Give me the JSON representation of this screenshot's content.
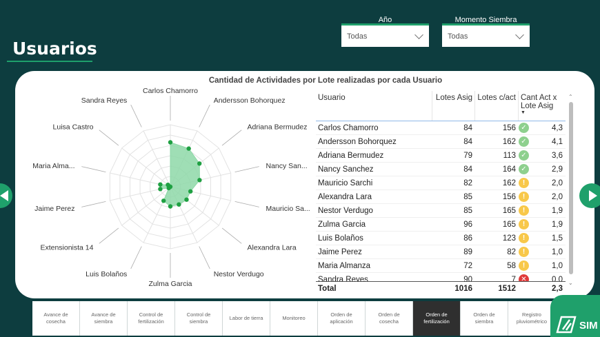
{
  "page": {
    "title": "Usuarios"
  },
  "filters": [
    {
      "label": "Año",
      "value": "Todas"
    },
    {
      "label": "Momento Siembra",
      "value": "Todas"
    }
  ],
  "chart_data": {
    "type": "radar",
    "title": "Cantidad de Actividades por Lote realizadas por cada Usuario",
    "categories": [
      "Carlos Chamorro",
      "Andersson Bohorquez",
      "Adriana Bermudez",
      "Nancy San...",
      "Mauricio Sa...",
      "Alexandra Lara",
      "Nestor Verdugo",
      "Zulma Garcia",
      "Luis Bolaños",
      "Extensionista 14",
      "Jaime Perez",
      "Maria Alma...",
      "Luisa Castro",
      "Sandra Reyes"
    ],
    "values": [
      4.3,
      4.1,
      3.6,
      2.9,
      2.0,
      2.0,
      1.9,
      1.9,
      1.5,
      0.2,
      1.0,
      1.0,
      0.3,
      0.0
    ],
    "rlim": [
      0,
      6
    ],
    "grid": true,
    "fill_color": "#8ed8a8",
    "point_color": "#1fa042"
  },
  "table": {
    "headers": {
      "user": "Usuario",
      "lotes_asig": "Lotes Asig",
      "lotes_cact": "Lotes c/act",
      "cant_act": "Cant Act x Lote Asig"
    },
    "sort_indicator": "▼",
    "rows": [
      {
        "user": "Carlos Chamorro",
        "la": "84",
        "lc": "156",
        "status": "ok",
        "value": "4,3"
      },
      {
        "user": "Andersson Bohorquez",
        "la": "84",
        "lc": "162",
        "status": "ok",
        "value": "4,1"
      },
      {
        "user": "Adriana Bermudez",
        "la": "79",
        "lc": "113",
        "status": "ok",
        "value": "3,6"
      },
      {
        "user": "Nancy Sanchez",
        "la": "84",
        "lc": "164",
        "status": "ok",
        "value": "2,9"
      },
      {
        "user": "Mauricio Sarchi",
        "la": "82",
        "lc": "162",
        "status": "warn",
        "value": "2,0"
      },
      {
        "user": "Alexandra Lara",
        "la": "85",
        "lc": "156",
        "status": "warn",
        "value": "2,0"
      },
      {
        "user": "Nestor Verdugo",
        "la": "85",
        "lc": "165",
        "status": "warn",
        "value": "1,9"
      },
      {
        "user": "Zulma Garcia",
        "la": "96",
        "lc": "165",
        "status": "warn",
        "value": "1,9"
      },
      {
        "user": "Luis Bolaños",
        "la": "86",
        "lc": "123",
        "status": "warn",
        "value": "1,5"
      },
      {
        "user": "Jaime Perez",
        "la": "89",
        "lc": "82",
        "status": "warn",
        "value": "1,0"
      },
      {
        "user": "Maria Almanza",
        "la": "72",
        "lc": "58",
        "status": "warn",
        "value": "1,0"
      },
      {
        "user": "Sandra Reyes",
        "la": "90",
        "lc": "7",
        "status": "bad",
        "value": "0,0"
      }
    ],
    "total": {
      "label": "Total",
      "la": "1016",
      "lc": "1512",
      "value": "2,3"
    }
  },
  "navbar": [
    {
      "label": "Avance de cosecha",
      "active": false
    },
    {
      "label": "Avance de siembra",
      "active": false
    },
    {
      "label": "Control de fertilización",
      "active": false
    },
    {
      "label": "Control de siembra",
      "active": false
    },
    {
      "label": "Labor de tierra",
      "active": false
    },
    {
      "label": "Monitoreo",
      "active": false
    },
    {
      "label": "Orden de aplicación",
      "active": false
    },
    {
      "label": "Orden de cosecha",
      "active": false
    },
    {
      "label": "Orden de fertilización",
      "active": true
    },
    {
      "label": "Orden de siembra",
      "active": false
    },
    {
      "label": "Registro pluviométrico",
      "active": false
    }
  ],
  "logo": {
    "text": "SIM"
  },
  "colors": {
    "background": "#0d3d3f",
    "accent": "#1fa06b",
    "ok": "#8ed08e",
    "warn": "#f8c84a",
    "bad": "#e03a3a"
  }
}
